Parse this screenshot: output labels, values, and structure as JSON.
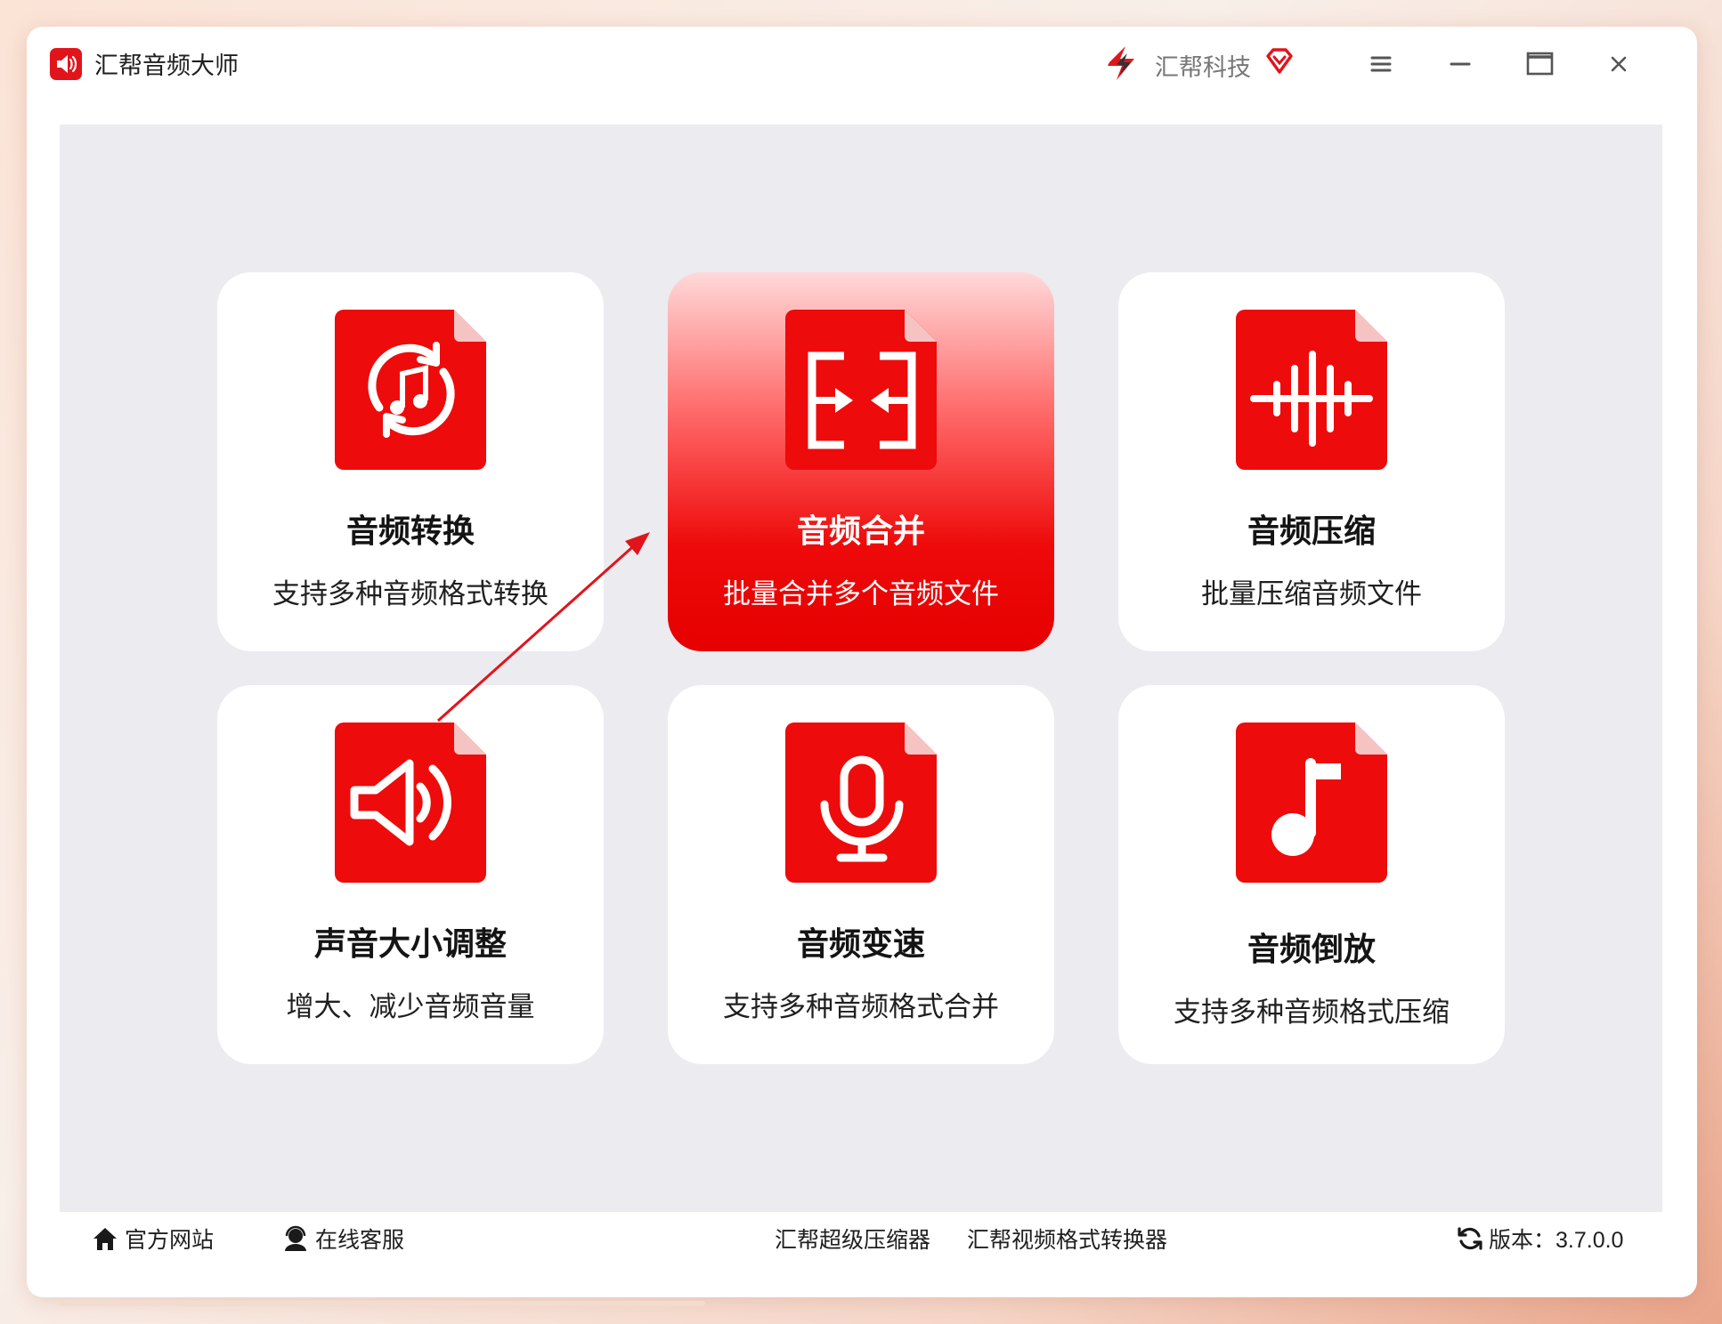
{
  "app": {
    "title": "汇帮音频大师",
    "brand": "汇帮科技",
    "accent_color": "#e60000"
  },
  "window_controls": [
    "menu-icon",
    "minimize-icon",
    "maximize-icon",
    "close-icon"
  ],
  "cards": [
    {
      "title": "音频转换",
      "desc": "支持多种音频格式转换",
      "icon": "audio-convert-icon",
      "active": false
    },
    {
      "title": "音频合并",
      "desc": "批量合并多个音频文件",
      "icon": "audio-merge-icon",
      "active": true
    },
    {
      "title": "音频压缩",
      "desc": "批量压缩音频文件",
      "icon": "audio-compress-icon",
      "active": false
    },
    {
      "title": "声音大小调整",
      "desc": "增大、减少音频音量",
      "icon": "volume-adjust-icon",
      "active": false
    },
    {
      "title": "音频变速",
      "desc": "支持多种音频格式合并",
      "icon": "microphone-icon",
      "active": false
    },
    {
      "title": "音频倒放",
      "desc": "支持多种音频格式压缩",
      "icon": "music-note-icon",
      "active": false
    }
  ],
  "footer": {
    "website": "官方网站",
    "support": "在线客服",
    "compressor": "汇帮超级压缩器",
    "video_converter": "汇帮视频格式转换器",
    "version_label": "版本：3.7.0.0"
  }
}
